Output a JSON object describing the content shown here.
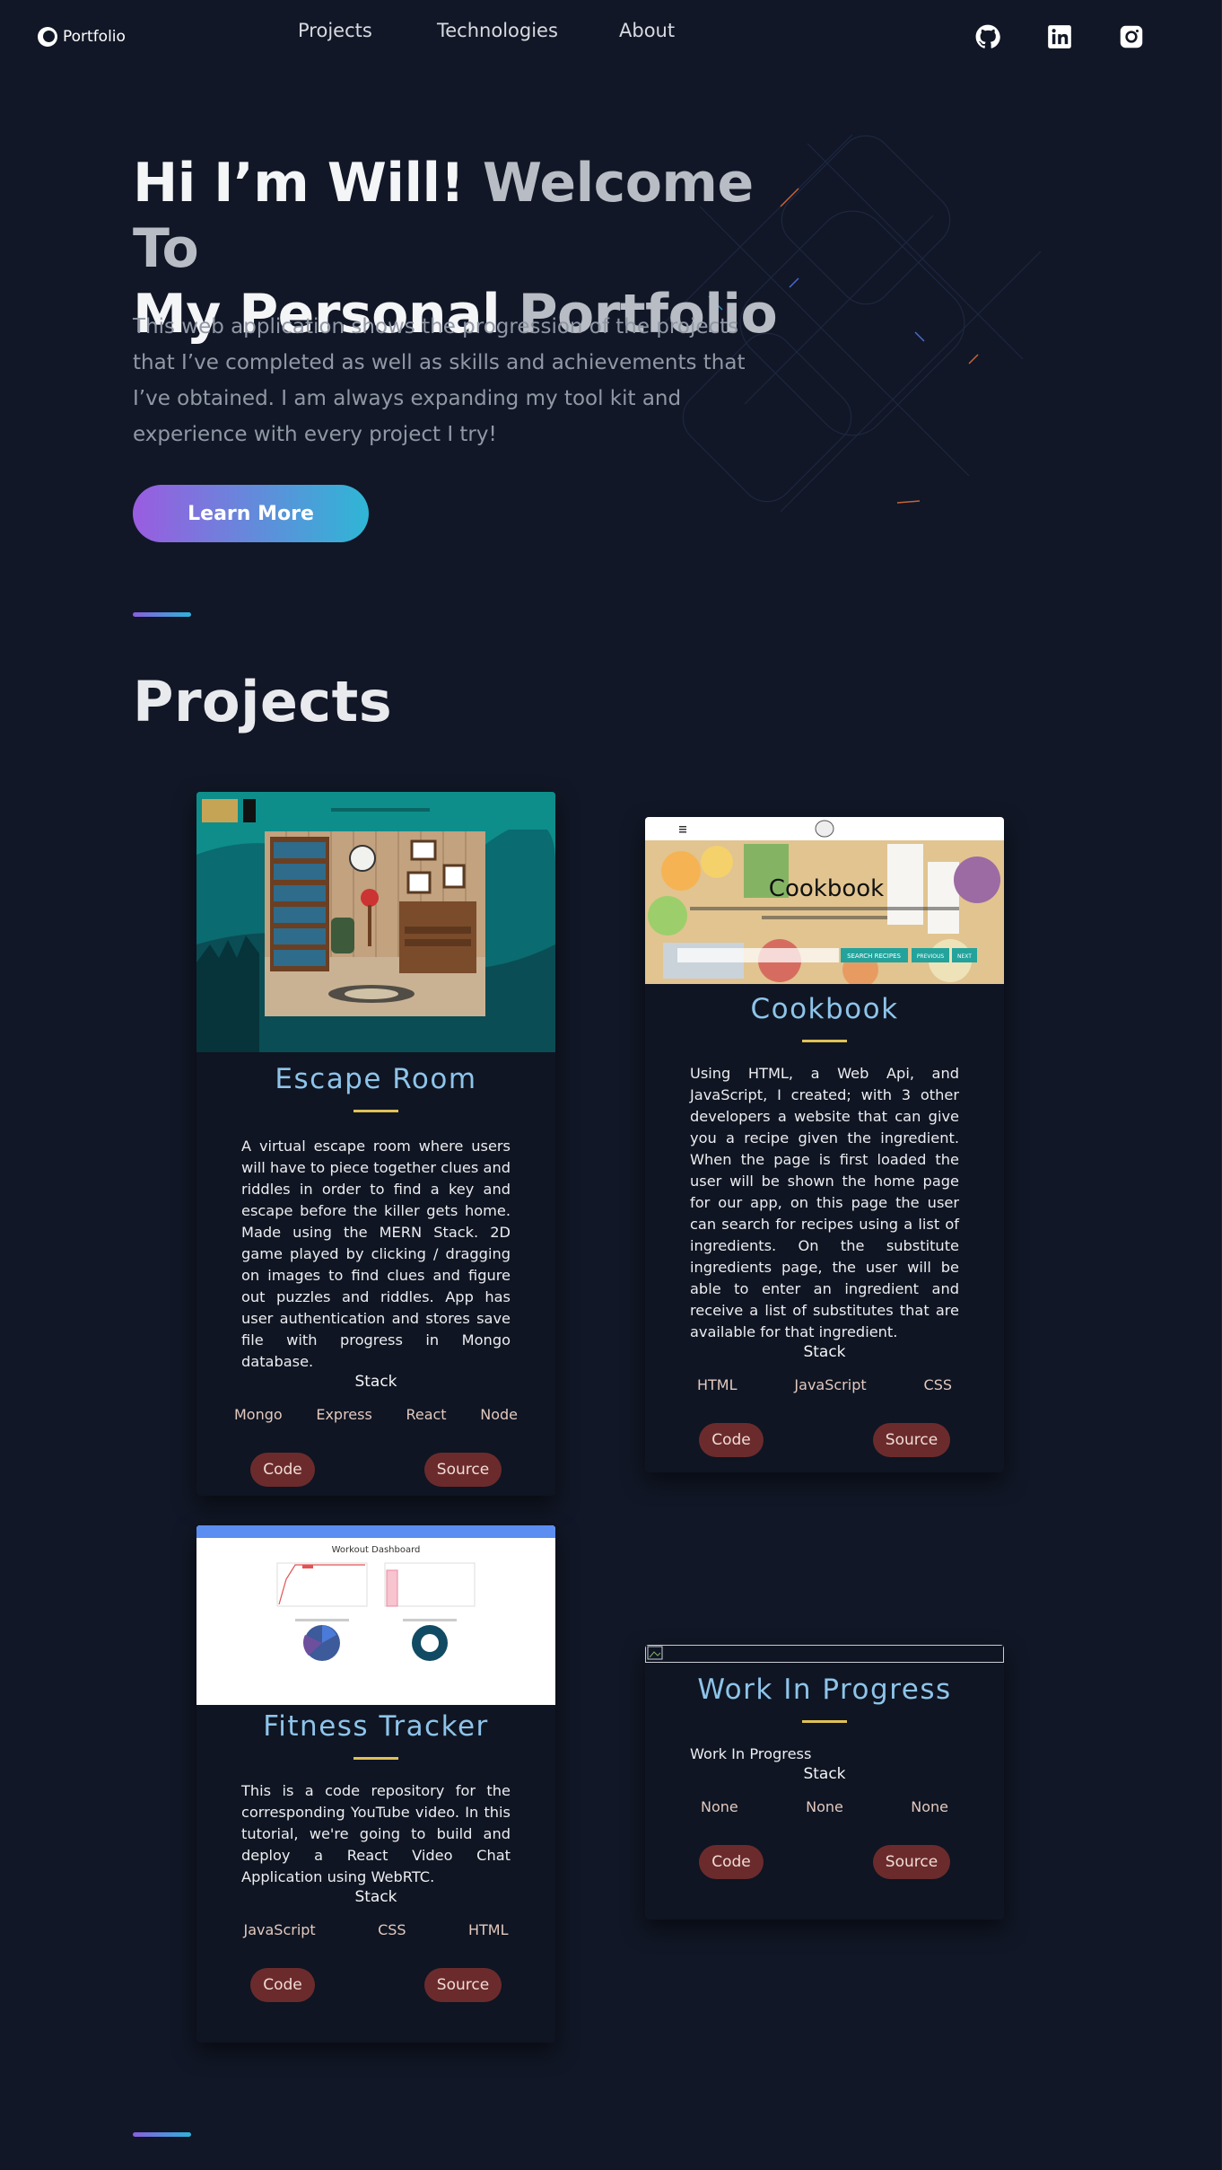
{
  "nav": {
    "logo_text": "Portfolio",
    "links": [
      "Projects",
      "Technologies",
      "About"
    ],
    "social": [
      "github-icon",
      "linkedin-icon",
      "instagram-icon"
    ]
  },
  "hero": {
    "title_white": "Hi I’m Will!",
    "title_grey_1": "Welcome To",
    "title_white_2": "My Personal",
    "title_grey_2": "Portfolio",
    "description": "This web application shows the progression of the projects that I’ve completed as well as skills and achievements that I’ve obtained. I am always expanding my tool kit and experience with every project I try!",
    "button": "Learn More"
  },
  "projects": {
    "title": "Projects",
    "stack_label": "Stack",
    "code_label": "Code",
    "source_label": "Source",
    "items": [
      {
        "title": "Escape Room",
        "description": "A virtual escape room where users will have to piece together clues and riddles in order to find a key and escape before the killer gets home. Made using the MERN Stack. 2D game played by clicking / dragging on images to find clues and figure out puzzles and riddles. App has user authentication and stores save file with progress in Mongo database.",
        "stack": [
          "Mongo",
          "Express",
          "React",
          "Node"
        ]
      },
      {
        "title": "Cookbook",
        "description": "Using HTML, a Web Api, and JavaScript, I created; with 3 other developers a website that can give you a recipe given the ingredient. When the page is first loaded the user will be shown the home page for our app, on this page the user can search for recipes using a list of ingredients. On the substitute ingredients page, the user will be able to enter an ingredient and receive a list of substitutes that are available for that ingredient.",
        "stack": [
          "HTML",
          "JavaScript",
          "CSS"
        ],
        "thumb_title": "Cookbook",
        "thumb_buttons": [
          "SEARCH RECIPES",
          "PREVIOUS",
          "NEXT"
        ]
      },
      {
        "title": "Fitness Tracker",
        "description": "This is a code repository for the corresponding YouTube video. In this tutorial, we're going to build and deploy a React Video Chat Application using WebRTC.",
        "stack": [
          "JavaScript",
          "CSS",
          "HTML"
        ],
        "thumb_title": "Workout Dashboard"
      },
      {
        "title": "Work In Progress",
        "description": "Work In Progress",
        "stack": [
          "None",
          "None",
          "None"
        ]
      }
    ]
  },
  "colors": {
    "background": "#111726",
    "accent_gradient_start": "#9a5ce0",
    "accent_gradient_end": "#2fb6d6",
    "card_title": "#8ec4ea",
    "rule": "#e0c156",
    "pill": "#6b2b2c"
  }
}
